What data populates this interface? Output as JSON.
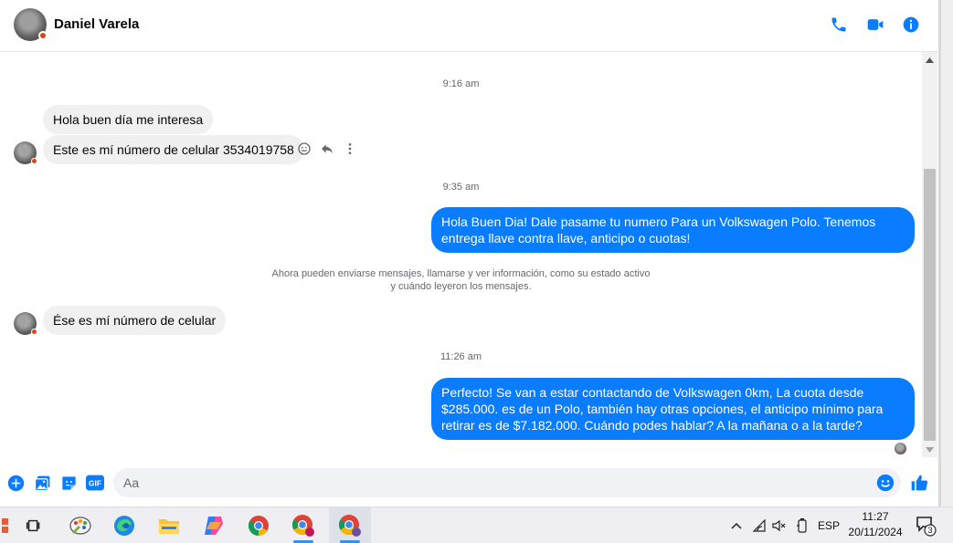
{
  "header": {
    "contact_name": "Daniel Varela",
    "icons": [
      "phone-icon",
      "video-camera-icon",
      "info-icon"
    ],
    "accent_color": "#0a7cff"
  },
  "messages": [
    {
      "type": "timestamp",
      "text": "9:16 am"
    },
    {
      "type": "incoming",
      "text": "Hola buen día me interesa"
    },
    {
      "type": "incoming",
      "text": "Este es mí número de celular 3534019758"
    },
    {
      "type": "timestamp",
      "text": "9:35 am"
    },
    {
      "type": "outgoing",
      "text": "Hola Buen Dia! Dale pasame tu numero Para un Volkswagen Polo. Tenemos entrega llave contra llave, anticipo o cuotas!"
    },
    {
      "type": "system",
      "line1": "Ahora pueden enviarse mensajes, llamarse y ver información, como su estado activo",
      "line2": "y cuándo leyeron los mensajes."
    },
    {
      "type": "incoming",
      "text": "Ése es mí número de celular"
    },
    {
      "type": "timestamp",
      "text": "11:26 am"
    },
    {
      "type": "outgoing",
      "text": "Perfecto!  Se van a estar contactando de Volkswagen 0km, La cuota desde $285.000. es de un Polo, también hay otras opciones, el anticipo mínimo para retirar es de $7.182.000. Cuándo podes hablar? A la mañana o a la tarde?"
    }
  ],
  "message_actions": [
    "react-icon",
    "reply-icon",
    "more-options-icon"
  ],
  "composer": {
    "placeholder": "Aa",
    "gif_label": "GIF",
    "icons": [
      "add-icon",
      "image-icon",
      "sticker-icon",
      "gif-icon",
      "emoji-icon",
      "like-icon"
    ]
  },
  "taskbar": {
    "apps": [
      "task-view-icon",
      "paint-app-icon",
      "edge-browser-icon",
      "file-explorer-icon",
      "copilot-icon",
      "chrome-icon",
      "chrome-profile-icon",
      "chrome-active-icon"
    ],
    "tray_language": "ESP",
    "clock_time": "11:27",
    "clock_date": "20/11/2024",
    "notification_count": "3"
  }
}
